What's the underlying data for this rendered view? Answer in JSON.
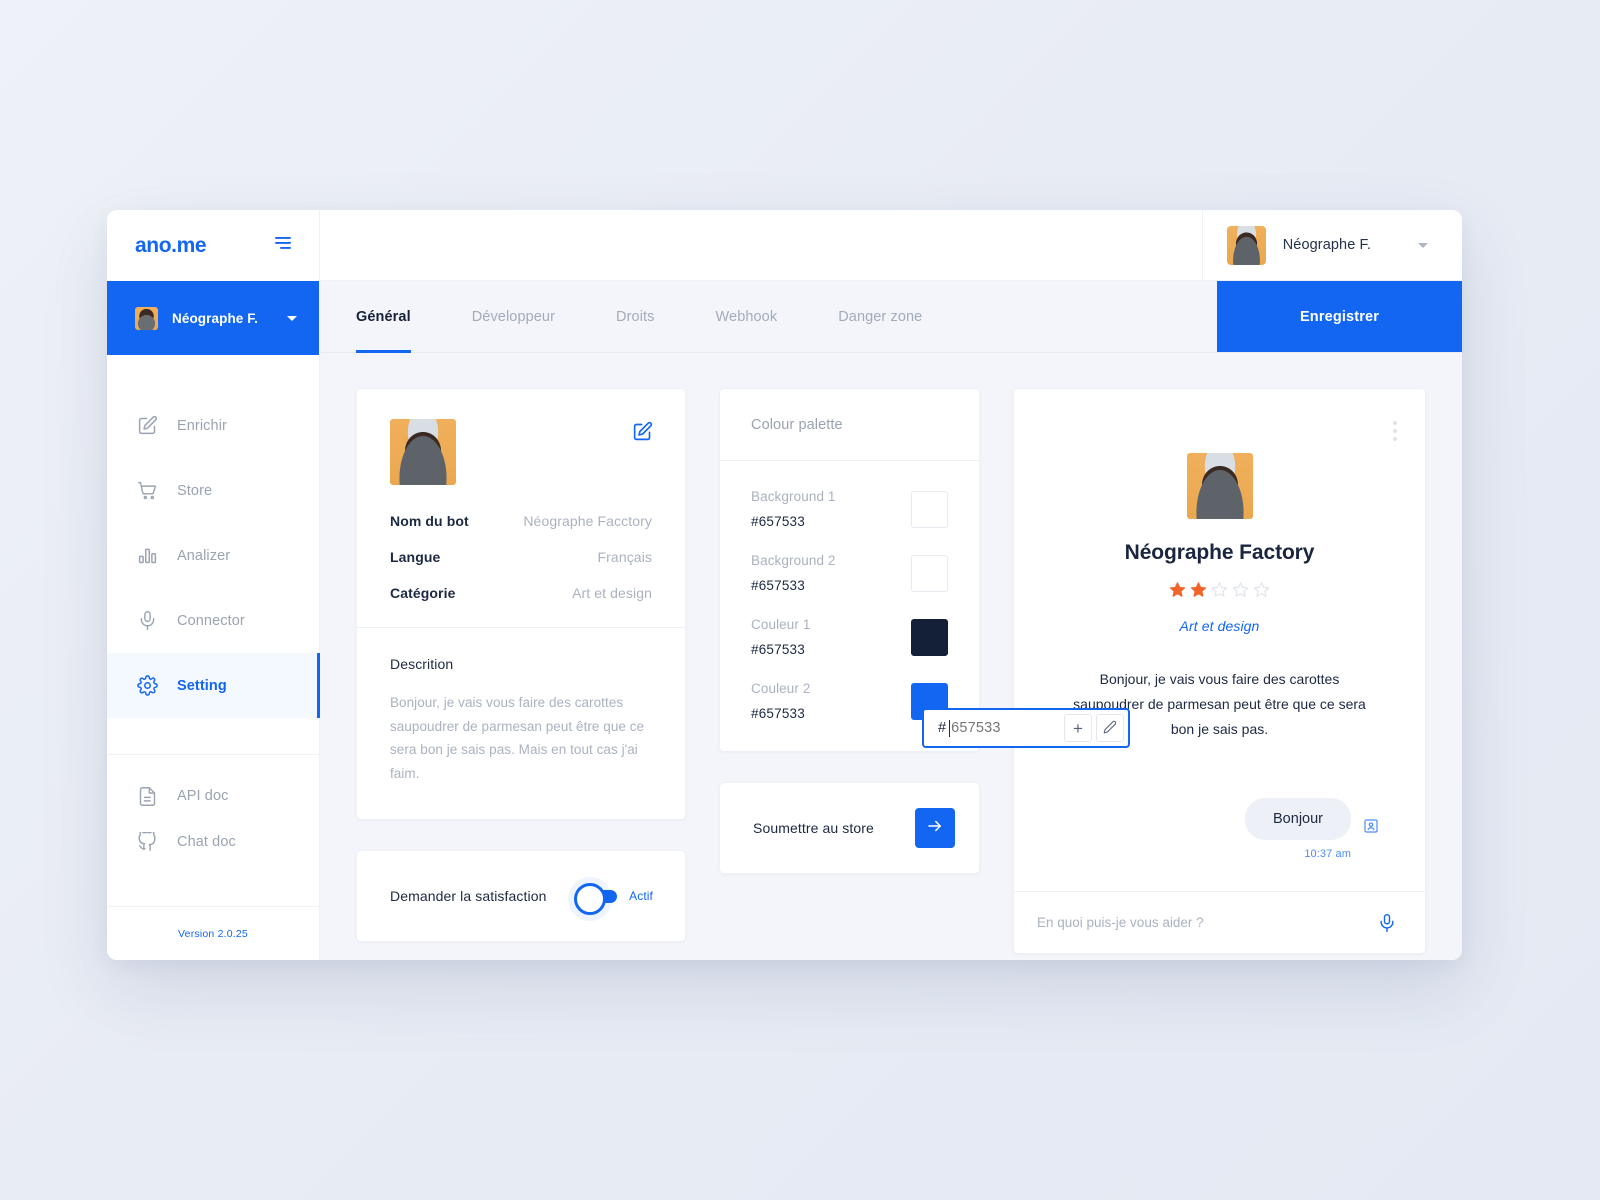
{
  "sidebar": {
    "logo": "ano.me",
    "menu_icon": "hamburger-icon",
    "account": {
      "name": "Néographe F.",
      "avatar": "user-avatar"
    },
    "items": [
      {
        "label": "Enrichir",
        "icon": "edit-square-icon",
        "badge": true,
        "active": false
      },
      {
        "label": "Store",
        "icon": "shopping-cart-icon",
        "badge": false,
        "active": false
      },
      {
        "label": "Analizer",
        "icon": "bar-chart-icon",
        "badge": false,
        "active": false
      },
      {
        "label": "Connector",
        "icon": "microphone-icon",
        "badge": false,
        "active": false
      },
      {
        "label": "Setting",
        "icon": "gear-icon",
        "badge": false,
        "active": true
      }
    ],
    "secondary_items": [
      {
        "label": "API doc",
        "icon": "document-icon"
      },
      {
        "label": "Chat doc",
        "icon": "github-icon"
      }
    ],
    "version": "Version 2.0.25"
  },
  "topbar": {
    "user_name": "Néographe F.",
    "avatar": "user-avatar",
    "caret": "chevron-down-icon"
  },
  "tabs": [
    {
      "label": "Général",
      "active": true
    },
    {
      "label": "Développeur",
      "active": false
    },
    {
      "label": "Droits",
      "active": false
    },
    {
      "label": "Webhook",
      "active": false
    },
    {
      "label": "Danger zone",
      "active": false
    }
  ],
  "save_button": "Enregistrer",
  "profile_card": {
    "edit_icon": "edit-square-icon",
    "rows": [
      {
        "key": "Nom du bot",
        "value": "Néographe Facctory"
      },
      {
        "key": "Langue",
        "value": "Français"
      },
      {
        "key": "Catégorie",
        "value": "Art et design"
      }
    ],
    "description_title": "Descrition",
    "description_text": "Bonjour, je vais vous faire des carottes saupoudrer de parmesan peut être que ce sera bon je sais pas. Mais en tout cas j'ai faim."
  },
  "satisfaction_card": {
    "label": "Demander la satisfaction",
    "toggle_on": true,
    "state_label": "Actif"
  },
  "palette_card": {
    "title": "Colour palette",
    "swatches": [
      {
        "name": "Background 1",
        "hex": "#657533",
        "color": "#ffffff"
      },
      {
        "name": "Background 2",
        "hex": "#657533",
        "color": "#ffffff"
      },
      {
        "name": "Couleur 1",
        "hex": "#657533",
        "color": "#141f38"
      },
      {
        "name": "Couleur 2",
        "hex": "#657533",
        "color": "#1266f1"
      }
    ]
  },
  "color_popover": {
    "hash": "#",
    "value": "",
    "placeholder": "657533",
    "add_label": "+",
    "pick_icon": "pencil-icon"
  },
  "store_card": {
    "label": "Soumettre au store",
    "button_icon": "arrow-right-icon"
  },
  "preview_card": {
    "menu_icon": "more-vertical-icon",
    "bot_name": "Néographe Factory",
    "rating": 2,
    "rating_max": 5,
    "category": "Art et design",
    "bot_message": "Bonjour, je vais vous faire des carottes saupoudrer de parmesan peut être que ce sera bon je sais pas.",
    "user_message": "Bonjour",
    "user_message_time": "10:37 am",
    "contact_icon": "contact-card-icon",
    "input_placeholder": "En quoi puis-je vous aider ?",
    "mic_icon": "microphone-icon"
  },
  "colors": {
    "accent": "#1266f1",
    "star_filled": "#f2652a",
    "star_empty": "#dfe3ea",
    "dark": "#141f38"
  }
}
